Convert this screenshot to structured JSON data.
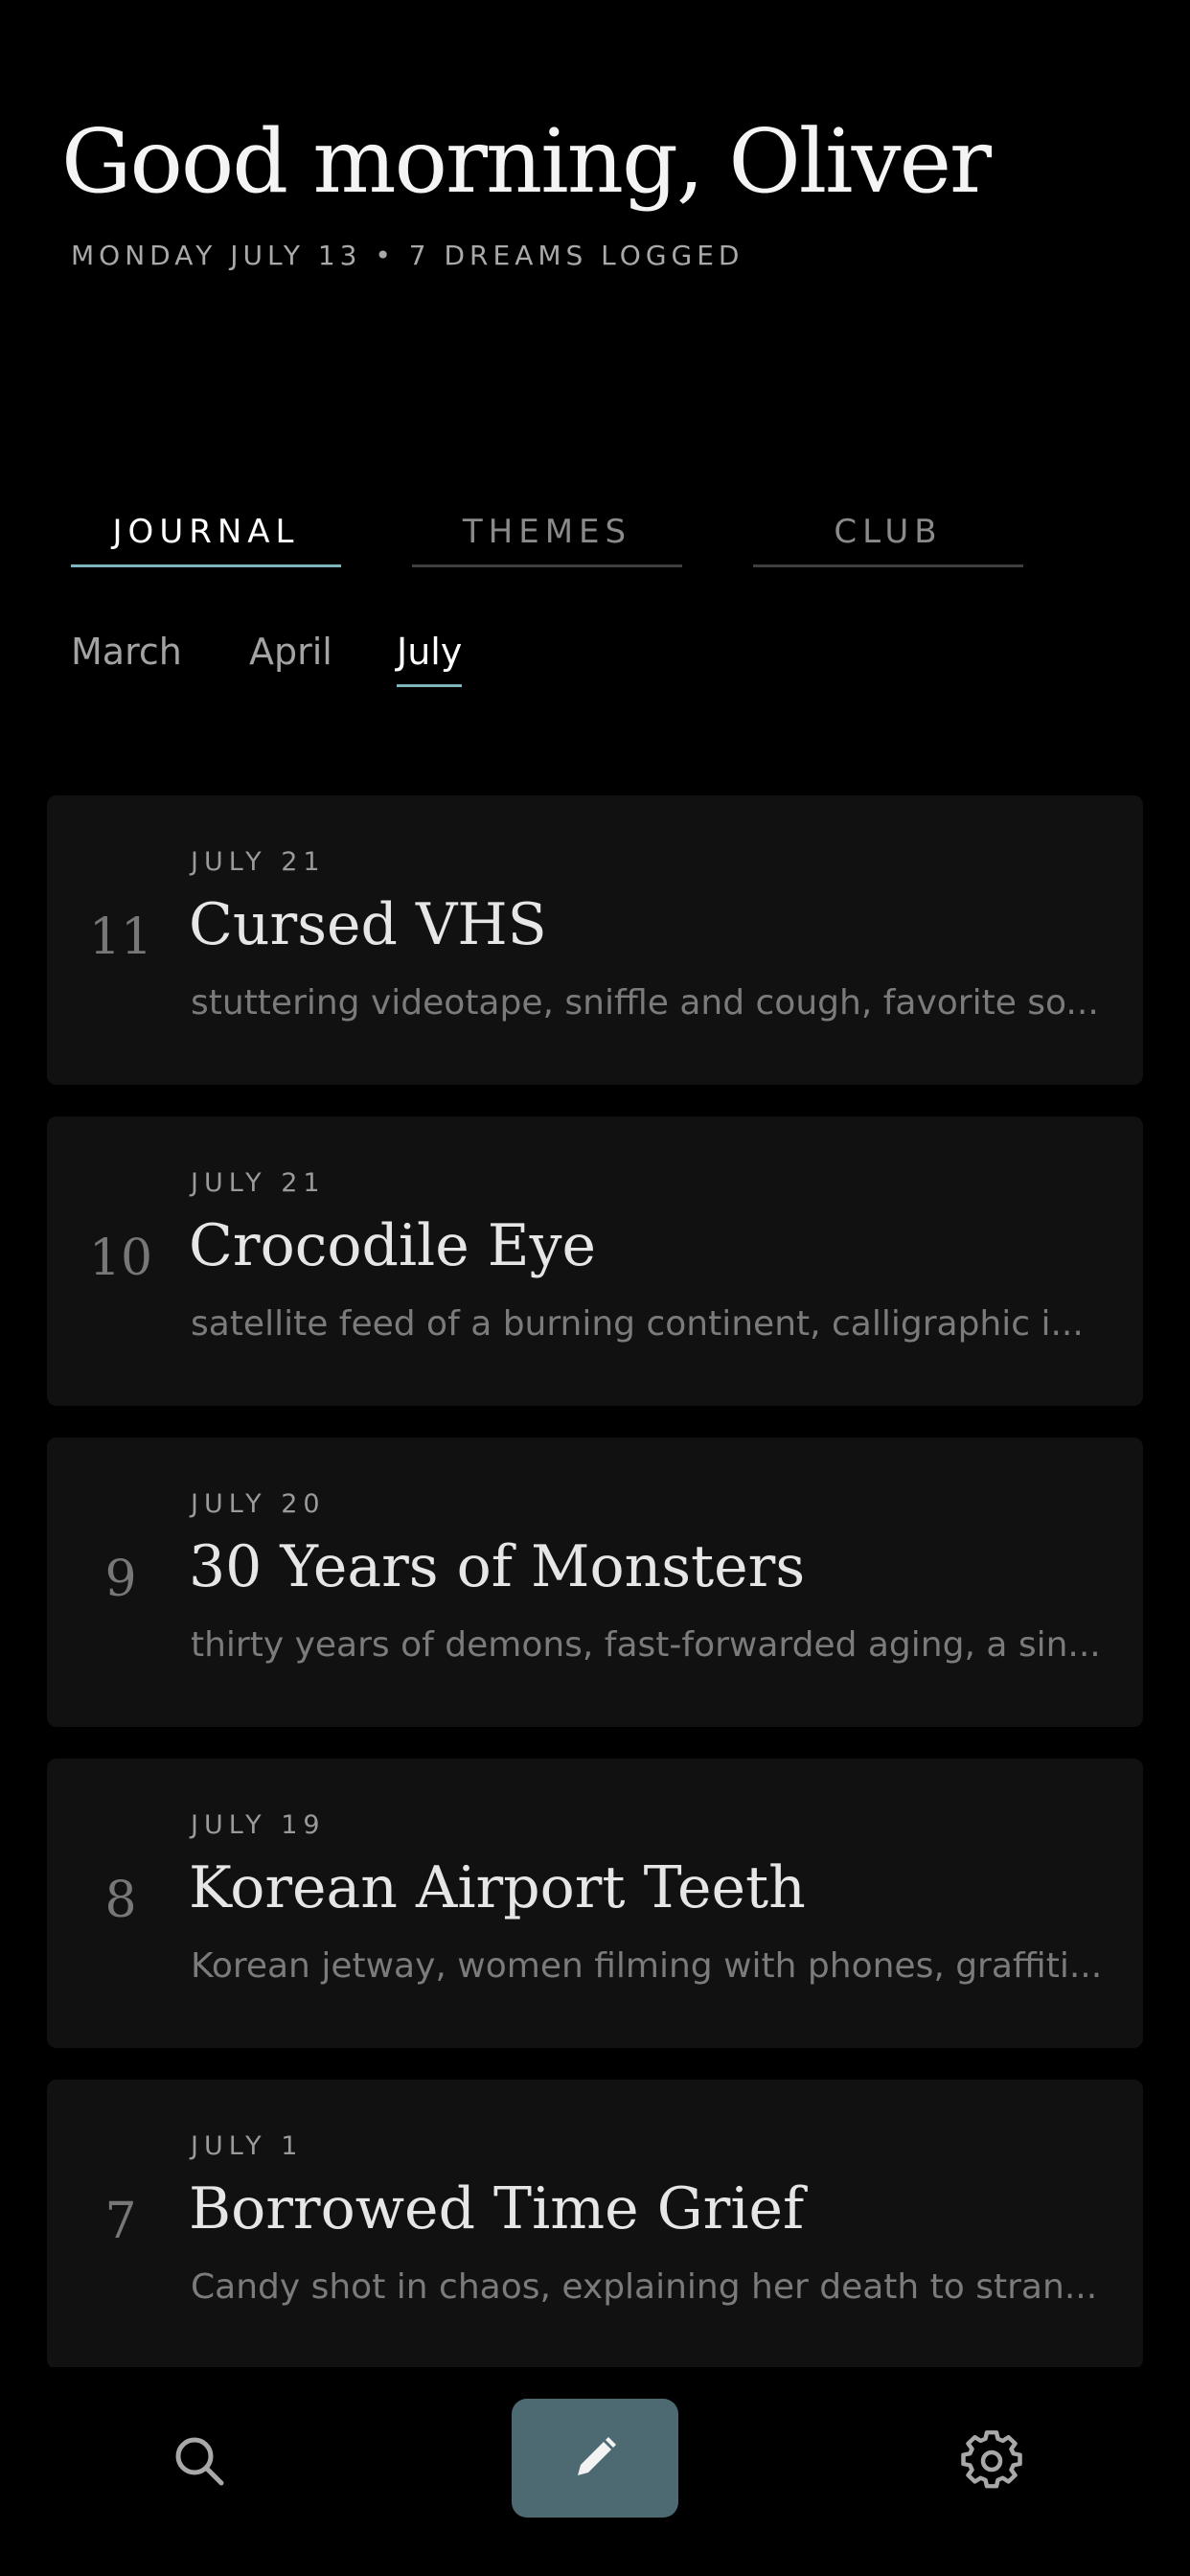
{
  "header": {
    "greeting": "Good morning, Oliver",
    "subline": "MONDAY JULY 13 • 7 DREAMS LOGGED"
  },
  "tabs": [
    {
      "label": "JOURNAL",
      "active": true
    },
    {
      "label": "THEMES",
      "active": false
    },
    {
      "label": "CLUB",
      "active": false
    }
  ],
  "months": [
    {
      "label": "March",
      "active": false
    },
    {
      "label": "April",
      "active": false
    },
    {
      "label": "July",
      "active": true
    }
  ],
  "entries": [
    {
      "number": "11",
      "date": "JULY 21",
      "title": "Cursed VHS",
      "summary": "stuttering videotape, sniffle and cough, favorite so..."
    },
    {
      "number": "10",
      "date": "JULY 21",
      "title": "Crocodile Eye",
      "summary": "satellite feed of a burning continent, calligraphic i..."
    },
    {
      "number": "9",
      "date": "JULY 20",
      "title": "30 Years of Monsters",
      "summary": "thirty years of demons, fast-forwarded aging, a sin..."
    },
    {
      "number": "8",
      "date": "JULY 19",
      "title": "Korean Airport Teeth",
      "summary": "Korean jetway, women filming with phones, graffiti..."
    },
    {
      "number": "7",
      "date": "JULY 1",
      "title": "Borrowed Time Grief",
      "summary": "Candy shot in chaos, explaining her death to stran..."
    }
  ],
  "bottom_nav": {
    "left_icon": "search-icon",
    "center_icon": "pencil-icon",
    "right_icon": "gear-icon"
  },
  "colors": {
    "background": "#000000",
    "card": "#111111",
    "accent": "#7fb6bd",
    "compose_button": "#4d6a73"
  }
}
